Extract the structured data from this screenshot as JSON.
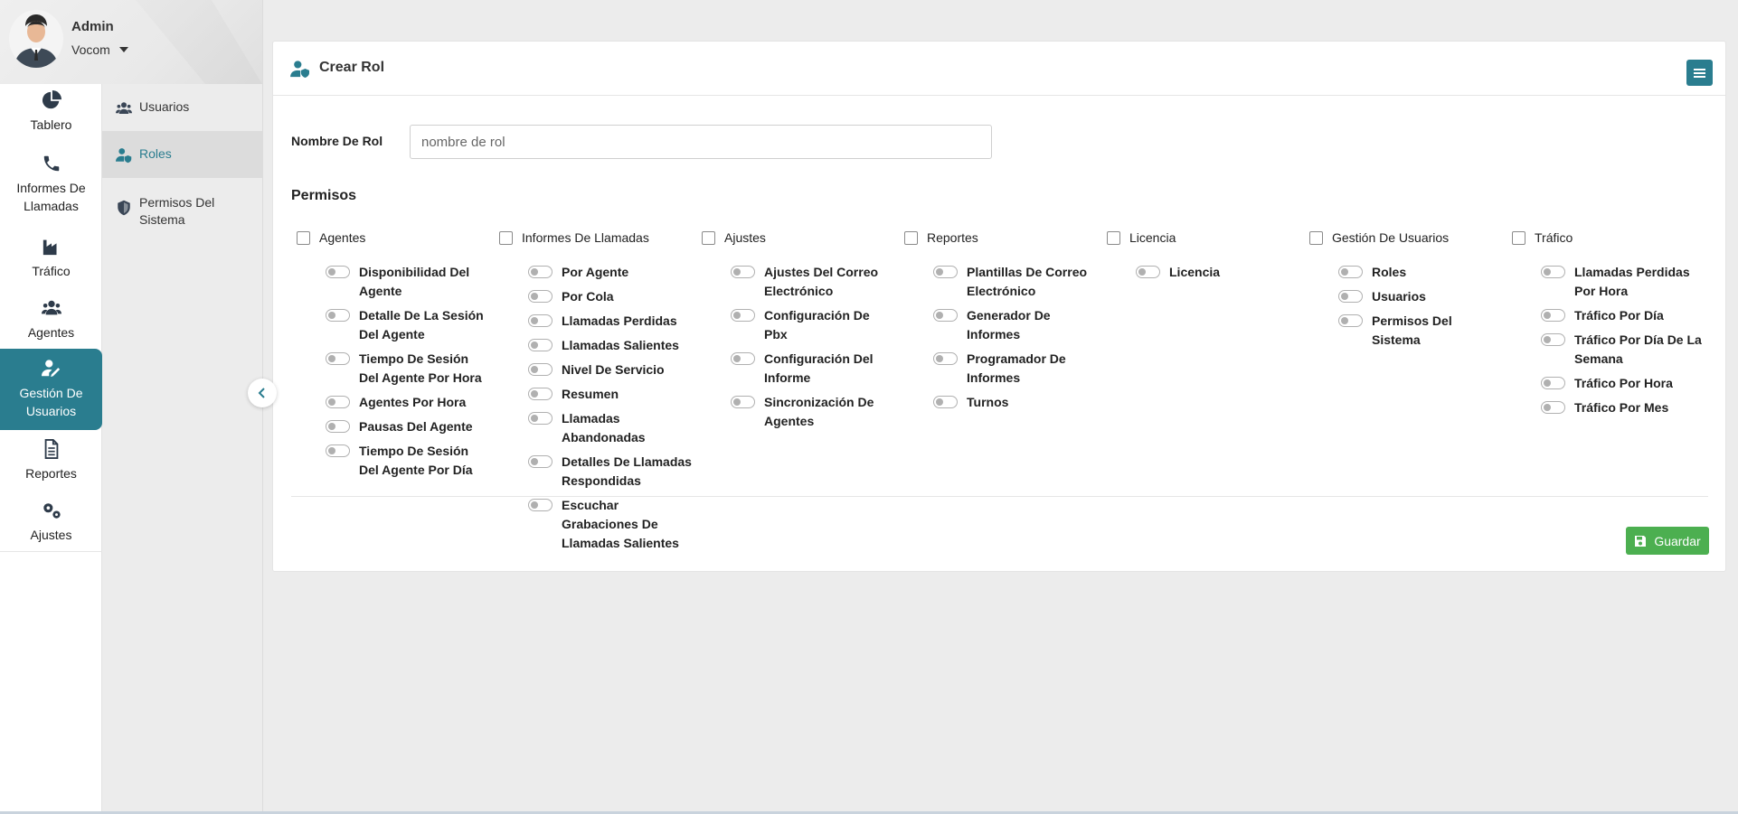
{
  "user": {
    "name": "Admin",
    "company": "Vocom"
  },
  "rail": {
    "items": [
      {
        "label": "Tablero",
        "icon": "pie-chart-icon"
      },
      {
        "label": "Informes De Llamadas",
        "icon": "phone-icon"
      },
      {
        "label": "Tráfico",
        "icon": "factory-icon"
      },
      {
        "label": "Agentes",
        "icon": "users-icon"
      },
      {
        "label": "Gestión De Usuarios",
        "icon": "user-edit-icon"
      },
      {
        "label": "Reportes",
        "icon": "file-icon"
      },
      {
        "label": "Ajustes",
        "icon": "gears-icon"
      }
    ]
  },
  "submenu": {
    "items": [
      {
        "label": "Usuarios",
        "icon": "users-icon"
      },
      {
        "label": "Roles",
        "icon": "user-shield-icon"
      },
      {
        "label": "Permisos Del Sistema",
        "icon": "shield-icon"
      }
    ]
  },
  "card": {
    "title": "Crear Rol",
    "role_label": "Nombre De Rol",
    "role_placeholder": "nombre de rol",
    "role_value": "",
    "permissions_title": "Permisos",
    "save_label": "Guardar"
  },
  "permissions": [
    {
      "group": "Agentes",
      "items": [
        "Disponibilidad Del Agente",
        "Detalle De La Sesión Del Agente",
        "Tiempo De Sesión Del Agente Por Hora",
        "Agentes Por Hora",
        "Pausas Del Agente",
        "Tiempo De Sesión Del Agente Por Día"
      ]
    },
    {
      "group": "Informes De Llamadas",
      "items": [
        "Por Agente",
        "Por Cola",
        "Llamadas Perdidas",
        "Llamadas Salientes",
        "Nivel De Servicio",
        "Resumen",
        "Llamadas Abandonadas",
        "Detalles De Llamadas Respondidas",
        "Escuchar Grabaciones De Llamadas Salientes"
      ]
    },
    {
      "group": "Ajustes",
      "items": [
        "Ajustes Del Correo Electrónico",
        "Configuración De Pbx",
        "Configuración Del Informe",
        "Sincronización De Agentes"
      ]
    },
    {
      "group": "Reportes",
      "items": [
        "Plantillas De Correo Electrónico",
        "Generador De Informes",
        "Programador De Informes",
        "Turnos"
      ]
    },
    {
      "group": "Licencia",
      "items": [
        "Licencia"
      ]
    },
    {
      "group": "Gestión De Usuarios",
      "items": [
        "Roles",
        "Usuarios",
        "Permisos Del Sistema"
      ]
    },
    {
      "group": "Tráfico",
      "items": [
        "Llamadas Perdidas Por Hora",
        "Tráfico Por Día",
        "Tráfico Por Día De La Semana",
        "Tráfico Por Hora",
        "Tráfico Por Mes"
      ]
    }
  ],
  "colors": {
    "accent": "#2a7d8f",
    "save": "#4caf50"
  }
}
